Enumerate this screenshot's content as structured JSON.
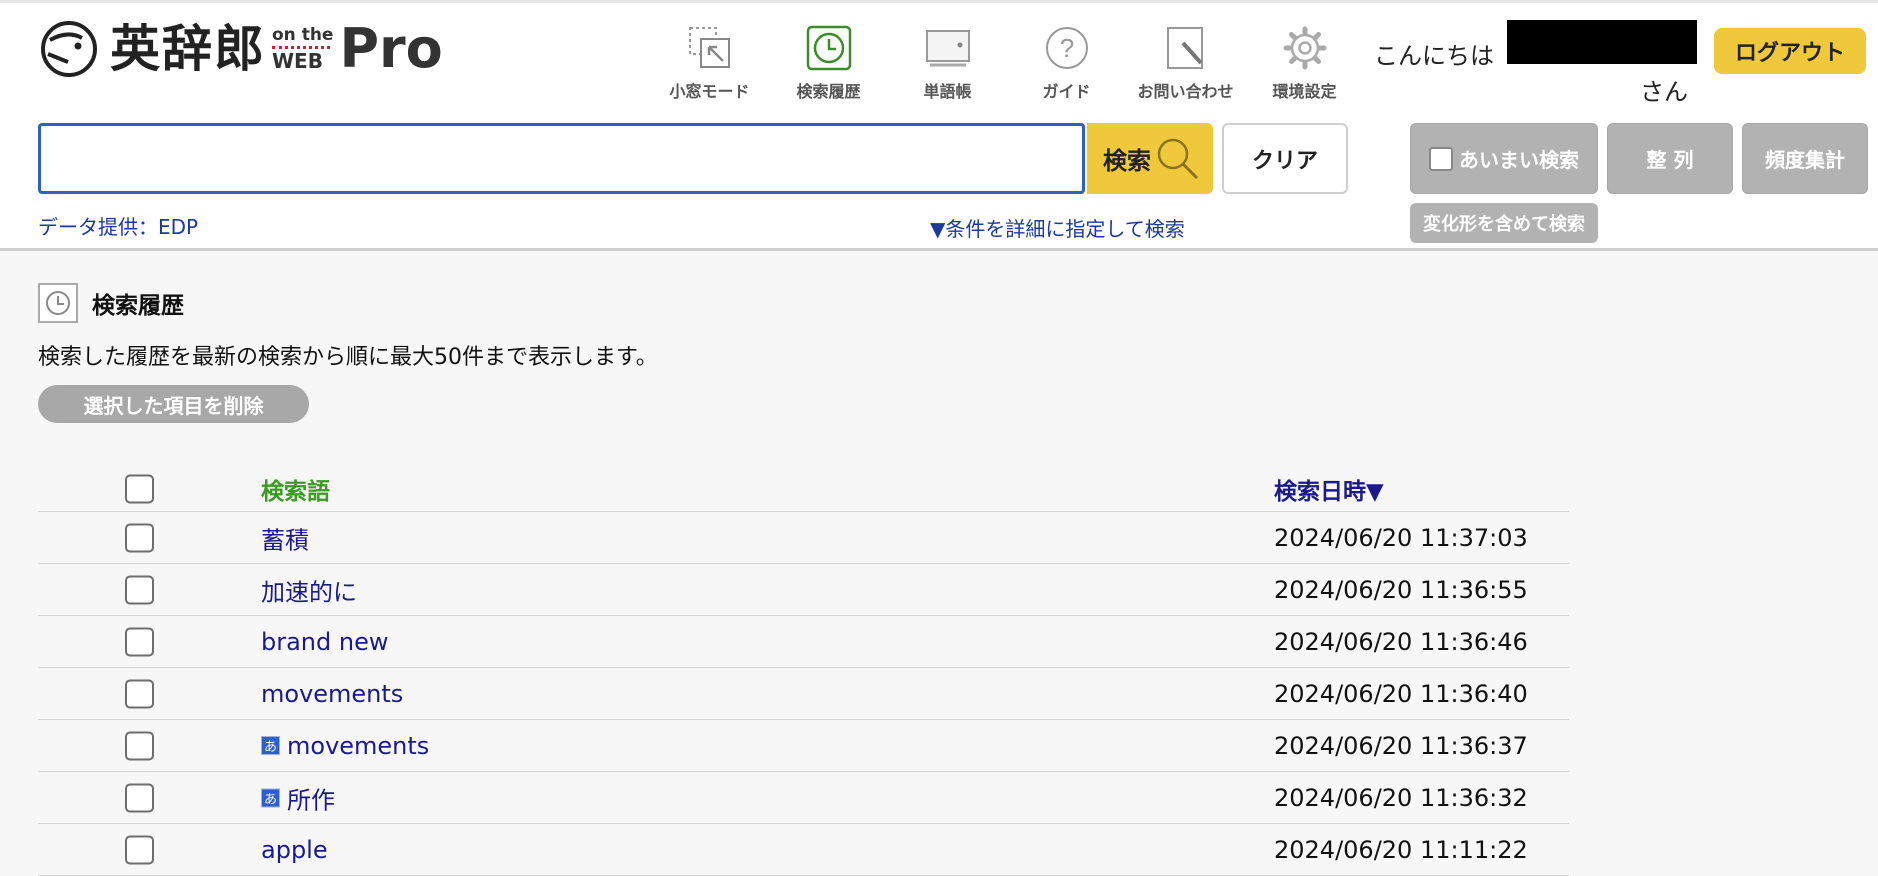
{
  "header": {
    "logo": {
      "main": "英辞郎",
      "on": "on the",
      "web": "WEB",
      "pro": "Pro"
    },
    "nav": [
      {
        "id": "mini-window",
        "label": "小窓モード",
        "icon": "mini-window-icon"
      },
      {
        "id": "history",
        "label": "検索履歴",
        "icon": "clock-icon"
      },
      {
        "id": "wordbook",
        "label": "単語帳",
        "icon": "wordbook-icon"
      },
      {
        "id": "guide",
        "label": "ガイド",
        "icon": "help-icon"
      },
      {
        "id": "contact",
        "label": "お問い合わせ",
        "icon": "pen-icon"
      },
      {
        "id": "settings",
        "label": "環境設定",
        "icon": "gear-icon"
      }
    ],
    "greeting": "こんにちは",
    "honorific": "さん",
    "logout_label": "ログアウト"
  },
  "search": {
    "value": "",
    "button_label": "検索",
    "clear_label": "クリア",
    "fuzzy_label": "あいまい検索",
    "sort_label": "整 列",
    "frequency_label": "頻度集計",
    "variant_label": "変化形を含めて検索",
    "data_source": "データ提供：EDP",
    "advanced_link": "▼条件を詳細に指定して検索"
  },
  "main": {
    "title": "検索履歴",
    "description": "検索した履歴を最新の検索から順に最大50件まで表示します。",
    "delete_label": "選択した項目を削除",
    "columns": {
      "term": "検索語",
      "date": "検索日時▼"
    },
    "jp_badge": "あ",
    "rows": [
      {
        "term": "蓄積",
        "date": "2024/06/20 11:37:03",
        "jp": false
      },
      {
        "term": "加速的に",
        "date": "2024/06/20 11:36:55",
        "jp": false
      },
      {
        "term": "brand new",
        "date": "2024/06/20 11:36:46",
        "jp": false
      },
      {
        "term": "movements",
        "date": "2024/06/20 11:36:40",
        "jp": false
      },
      {
        "term": "movements",
        "date": "2024/06/20 11:36:37",
        "jp": true
      },
      {
        "term": "所作",
        "date": "2024/06/20 11:36:32",
        "jp": true
      },
      {
        "term": "apple",
        "date": "2024/06/20 11:11:22",
        "jp": false
      }
    ]
  },
  "colors": {
    "accent_yellow": "#efc93b",
    "link_blue": "#1a1a8c",
    "header_green": "#3a9a22",
    "input_border": "#2a62c9"
  }
}
